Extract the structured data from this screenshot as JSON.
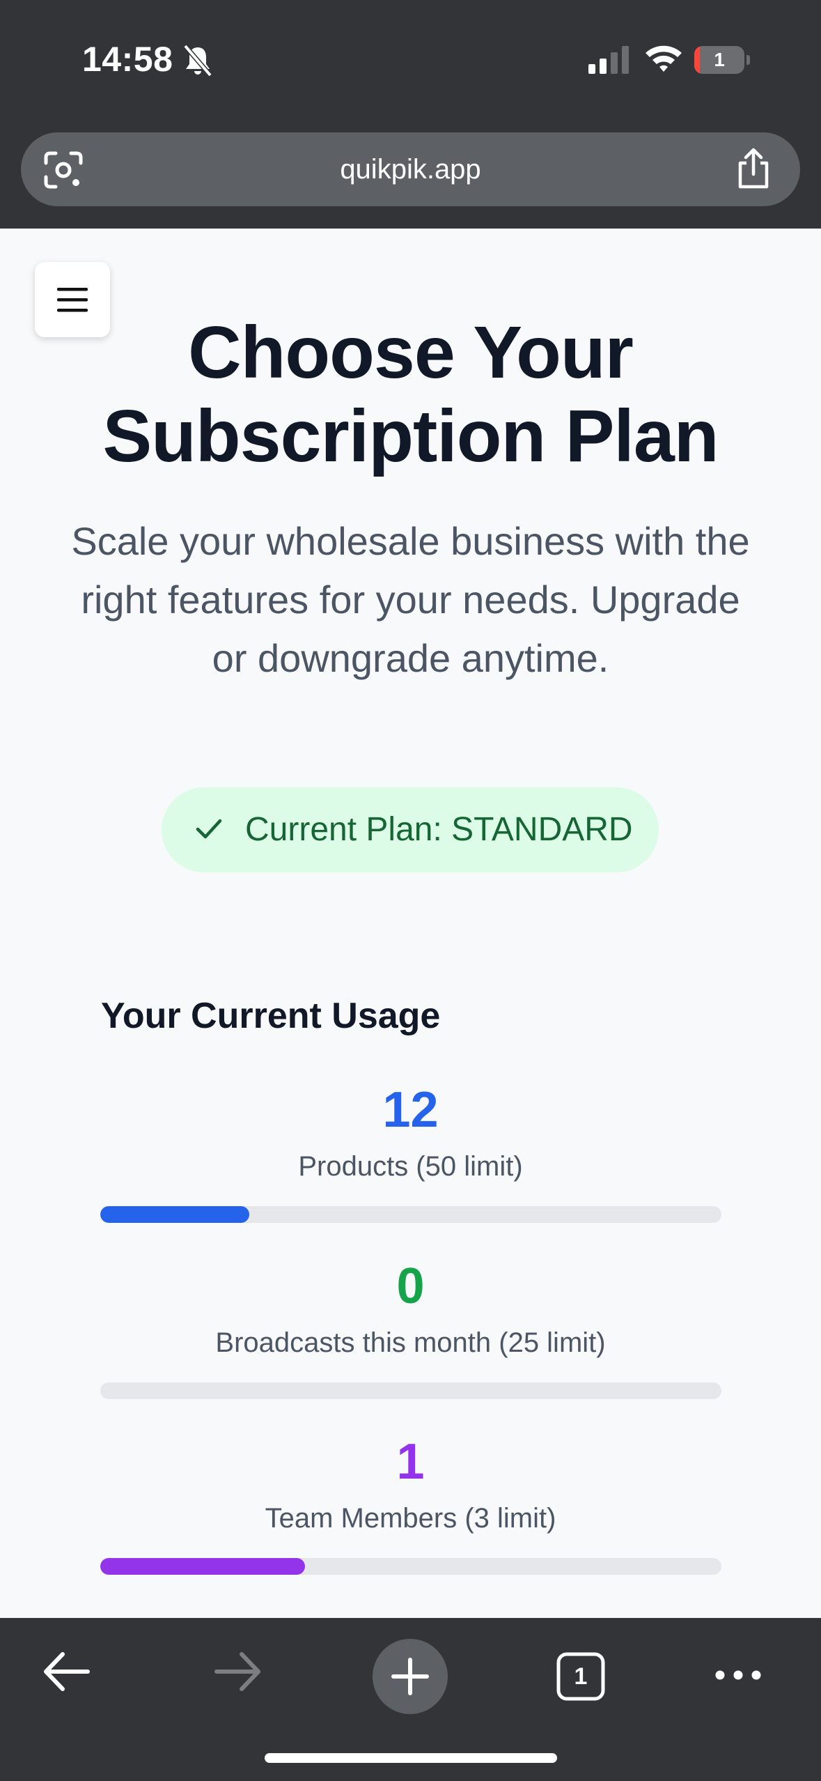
{
  "status_bar": {
    "time": "14:58",
    "battery_level": "1"
  },
  "browser": {
    "url": "quikpik.app",
    "tab_count": "1"
  },
  "page": {
    "title_line1": "Choose Your",
    "title_line2": "Subscription Plan",
    "subtitle_line1": "Scale your wholesale business with the",
    "subtitle_line2": "right features for your needs. Upgrade",
    "subtitle_line3": "or downgrade anytime.",
    "current_plan": "Current Plan: STANDARD",
    "usage_heading": "Your Current Usage",
    "usage": [
      {
        "value": "12",
        "label": "Products (50 limit)",
        "fraction": 0.24,
        "color": "#2563eb"
      },
      {
        "value": "0",
        "label": "Broadcasts this month (25 limit)",
        "fraction": 0,
        "color": "#16a34a"
      },
      {
        "value": "1",
        "label": "Team Members (3 limit)",
        "fraction": 0.33,
        "color": "#9333ea"
      }
    ]
  },
  "colors": {
    "accent_blue": "#2563eb",
    "accent_green": "#16a34a",
    "accent_purple": "#9333ea",
    "badge_bg": "#dcfce7",
    "badge_text": "#166534"
  },
  "icons": {
    "status": [
      "bell-slash-icon",
      "signal-icon",
      "wifi-icon",
      "battery-icon"
    ],
    "url_bar": [
      "lens-icon",
      "share-icon"
    ],
    "toolbar": [
      "back-arrow-icon",
      "forward-arrow-icon",
      "plus-icon",
      "tabs-icon",
      "more-icon"
    ],
    "page": [
      "hamburger-menu-icon",
      "check-icon"
    ]
  }
}
